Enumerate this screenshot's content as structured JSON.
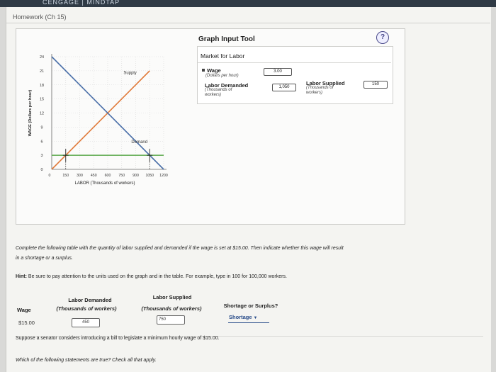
{
  "app": {
    "brand": "CENGAGE | MINDTAP"
  },
  "page_title": "Homework (Ch 15)",
  "tool": {
    "title": "Graph Input Tool",
    "help": "?",
    "subtitle": "Market for Labor",
    "wage_label": "Wage",
    "wage_sub": "(Dollars per hour)",
    "wage_value": "3.00",
    "demanded_label": "Labor Demanded",
    "demanded_sub1": "(Thousands of",
    "demanded_sub2": "workers)",
    "demanded_value": "1,050",
    "supplied_label": "Labor Supplied",
    "supplied_sub1": "(Thousands of",
    "supplied_sub2": "workers)",
    "supplied_value": "150"
  },
  "chart_data": {
    "type": "line",
    "xlabel": "LABOR (Thousands of workers)",
    "ylabel": "WAGE (Dollars per hour)",
    "x_ticks": [
      "0",
      "150",
      "300",
      "450",
      "600",
      "750",
      "900",
      "1050",
      "1200"
    ],
    "y_ticks": [
      "0",
      "3",
      "6",
      "9",
      "12",
      "15",
      "18",
      "21",
      "24"
    ],
    "xlim": [
      0,
      1200
    ],
    "ylim": [
      0,
      24
    ],
    "series": [
      {
        "name": "Supply",
        "color": "#e07a3a",
        "points": [
          [
            0,
            0
          ],
          [
            1050,
            21
          ]
        ]
      },
      {
        "name": "Demand",
        "color": "#4a6fa8",
        "points": [
          [
            0,
            24
          ],
          [
            1200,
            0
          ]
        ]
      },
      {
        "name": "",
        "color": "#5aa84a",
        "points": [
          [
            0,
            3
          ],
          [
            1200,
            3
          ]
        ]
      }
    ],
    "markers": [
      {
        "x": 150,
        "y": 3,
        "symbol": "+"
      },
      {
        "x": 1050,
        "y": 3,
        "symbol": "+"
      }
    ],
    "labels": {
      "supply": "Supply",
      "demand": "Demand"
    }
  },
  "question": {
    "text1": "Complete the following table with the quantity of labor supplied and demanded if the wage is set at $15.00. Then indicate whether this wage will result",
    "text2": "in a shortage or a surplus.",
    "hint_bold": "Hint:",
    "hint": "Be sure to pay attention to the units used on the graph and in the table. For example, type in 100 for 100,000 workers."
  },
  "table": {
    "col_wage": "Wage",
    "col_demanded": "Labor Demanded",
    "col_demanded_sub": "(Thousands of workers)",
    "col_supplied": "Labor Supplied",
    "col_supplied_sub": "(Thousands of workers)",
    "col_result": "Shortage or Surplus?",
    "row_wage": "$15.00",
    "row_demanded": "450",
    "row_supplied": "750",
    "row_result": "Shortage"
  },
  "followup": {
    "text1": "Suppose a senator considers introducing a bill to legislate a minimum hourly wage of $15.00.",
    "text2": "Which of the following statements are true? Check all that apply."
  }
}
